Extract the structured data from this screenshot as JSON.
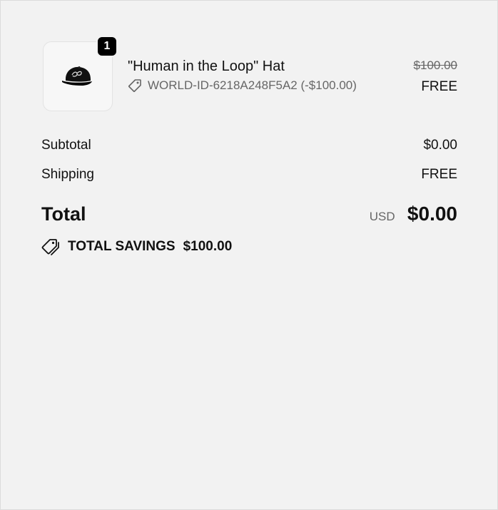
{
  "line_item": {
    "quantity": "1",
    "title": "\"Human in the Loop\" Hat",
    "discount_code": "WORLD-ID-6218A248F5A2 (-$100.00)",
    "original_price": "$100.00",
    "final_price": "FREE",
    "image_icon": "black-cap-icon"
  },
  "summary": {
    "subtotal_label": "Subtotal",
    "subtotal_value": "$0.00",
    "shipping_label": "Shipping",
    "shipping_value": "FREE",
    "total_label": "Total",
    "currency": "USD",
    "total_value": "$0.00",
    "savings_label": "TOTAL SAVINGS",
    "savings_value": "$100.00"
  },
  "colors": {
    "background": "#f2f2f2",
    "text": "#111111",
    "muted": "#666666",
    "badge": "#000000"
  }
}
